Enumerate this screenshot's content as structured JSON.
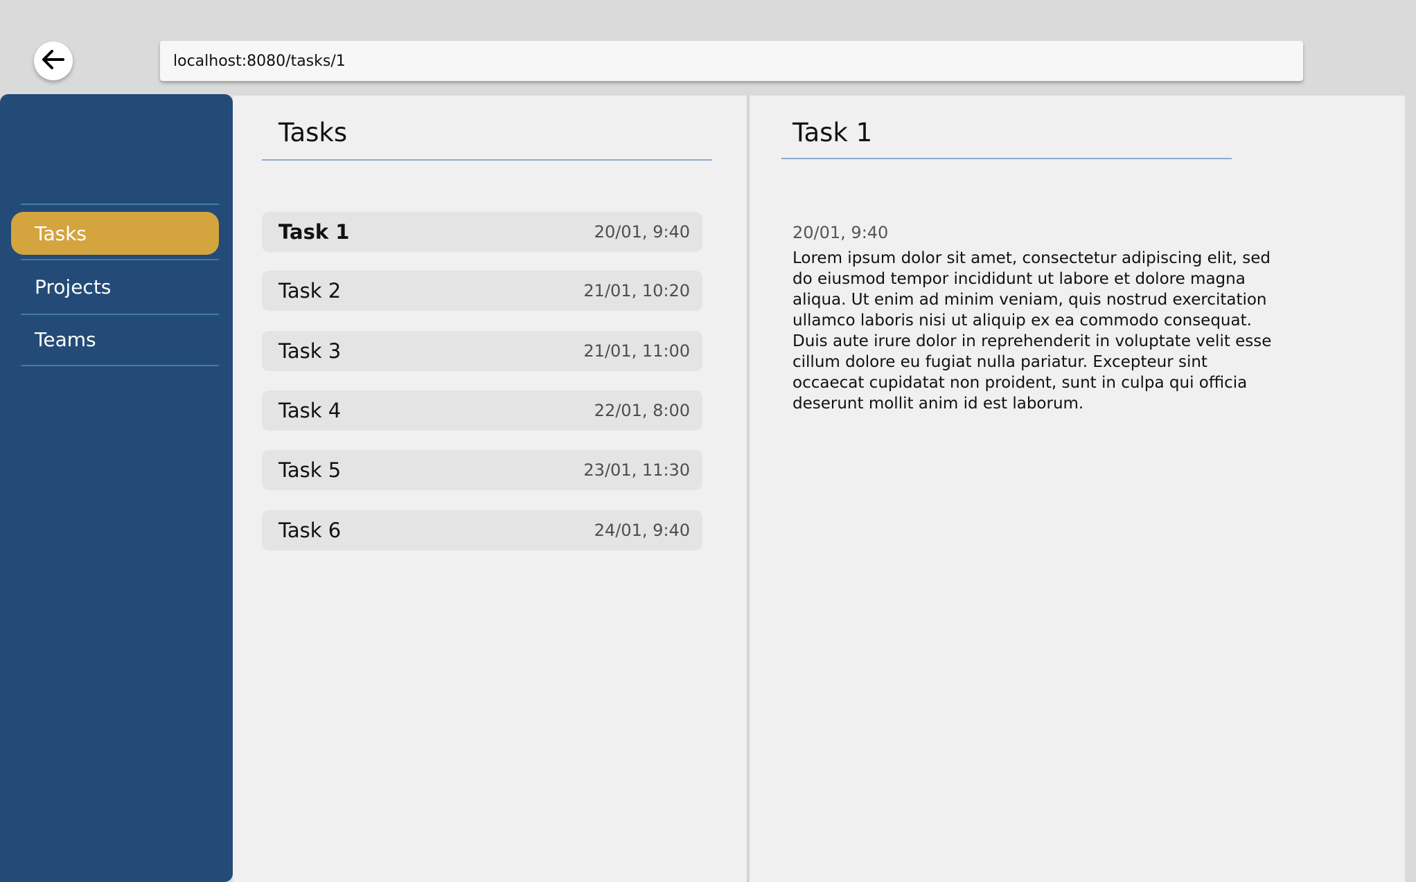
{
  "browser": {
    "url": "localhost:8080/tasks/1",
    "back_icon": "arrow-left-icon"
  },
  "sidebar": {
    "items": [
      {
        "label": "Tasks",
        "active": true
      },
      {
        "label": "Projects",
        "active": false
      },
      {
        "label": "Teams",
        "active": false
      }
    ],
    "colors": {
      "background": "#244b78",
      "active": "#d4a43f",
      "divider": "#3f7fa6"
    }
  },
  "list": {
    "title": "Tasks",
    "tasks": [
      {
        "name": "Task 1",
        "date": "20/01, 9:40",
        "selected": true
      },
      {
        "name": "Task 2",
        "date": "21/01, 10:20",
        "selected": false
      },
      {
        "name": "Task 3",
        "date": "21/01, 11:00",
        "selected": false
      },
      {
        "name": "Task 4",
        "date": "22/01, 8:00",
        "selected": false
      },
      {
        "name": "Task 5",
        "date": "23/01, 11:30",
        "selected": false
      },
      {
        "name": "Task 6",
        "date": "24/01, 9:40",
        "selected": false
      }
    ]
  },
  "detail": {
    "title": "Task 1",
    "date": "20/01, 9:40",
    "body": "Lorem ipsum dolor sit amet, consectetur adipiscing elit, sed do eiusmod tempor incididunt ut labore et dolore magna aliqua. Ut enim ad minim veniam, quis nostrud exercitation ullamco laboris nisi ut aliquip ex ea commodo consequat. Duis aute irure dolor in reprehenderit in voluptate velit esse cillum dolore eu fugiat nulla pariatur. Excepteur sint occaecat cupidatat non proident, sunt in culpa qui officia deserunt mollit anim id est laborum."
  }
}
